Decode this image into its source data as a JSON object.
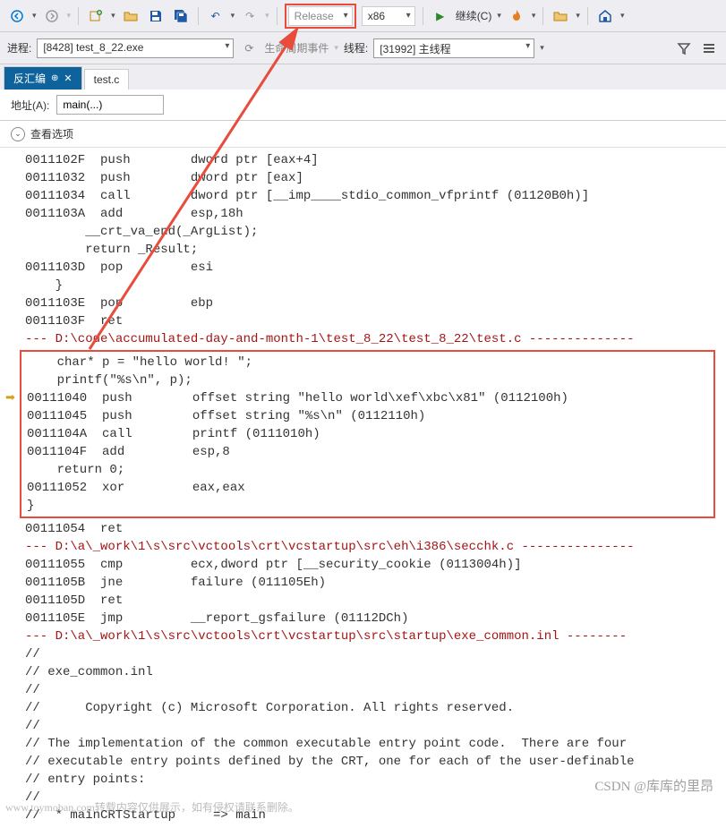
{
  "toolbar": {
    "config": "Release",
    "platform": "x86",
    "continue_label": "继续(C)"
  },
  "subbar": {
    "process_label": "进程:",
    "process_value": "[8428] test_8_22.exe",
    "lifecycle_label": "生命周期事件",
    "thread_label": "线程:",
    "thread_value": "[31992] 主线程"
  },
  "tabs": {
    "disasm": "反汇编",
    "file": "test.c"
  },
  "address": {
    "label": "地址(A):",
    "value": "main(...)"
  },
  "view_options": "查看选项",
  "code": [
    {
      "t": "0011102F  push        dword ptr [eax+4]  "
    },
    {
      "t": "00111032  push        dword ptr [eax]  "
    },
    {
      "t": "00111034  call        dword ptr [__imp____stdio_common_vfprintf (01120B0h)]  "
    },
    {
      "t": "0011103A  add         esp,18h  "
    },
    {
      "t": "        __crt_va_end(_ArgList);"
    },
    {
      "t": "        return _Result;"
    },
    {
      "t": "0011103D  pop         esi  "
    },
    {
      "t": "    }"
    },
    {
      "t": "0011103E  pop         ebp  "
    },
    {
      "t": "0011103F  ret  "
    },
    {
      "t": "--- D:\\code\\accumulated-day-and-month-1\\test_8_22\\test_8_22\\test.c --------------",
      "red": true
    }
  ],
  "boxed_code": [
    {
      "t": "    char* p = \"hello world! \";"
    },
    {
      "t": "    printf(\"%s\\n\", p);"
    },
    {
      "t": "00111040  push        offset string \"hello world\\xef\\xbc\\x81\" (0112100h)  ",
      "arrow": true
    },
    {
      "t": "00111045  push        offset string \"%s\\n\" (0112110h)  "
    },
    {
      "t": "0011104A  call        printf (0111010h)  "
    },
    {
      "t": "0011104F  add         esp,8  "
    },
    {
      "t": "    return 0;"
    },
    {
      "t": "00111052  xor         eax,eax  "
    },
    {
      "t": "}"
    }
  ],
  "code_after": [
    {
      "t": "00111054  ret  "
    },
    {
      "t": "--- D:\\a\\_work\\1\\s\\src\\vctools\\crt\\vcstartup\\src\\eh\\i386\\secchk.c ---------------",
      "red": true
    },
    {
      "t": "00111055  cmp         ecx,dword ptr [__security_cookie (0113004h)]  "
    },
    {
      "t": "0011105B  jne         failure (011105Eh)  "
    },
    {
      "t": "0011105D  ret  "
    },
    {
      "t": "0011105E  jmp         __report_gsfailure (01112DCh)  "
    },
    {
      "t": "--- D:\\a\\_work\\1\\s\\src\\vctools\\crt\\vcstartup\\src\\startup\\exe_common.inl --------",
      "red": true
    },
    {
      "t": "//"
    },
    {
      "t": "// exe_common.inl"
    },
    {
      "t": "//"
    },
    {
      "t": "//      Copyright (c) Microsoft Corporation. All rights reserved."
    },
    {
      "t": "//"
    },
    {
      "t": "// The implementation of the common executable entry point code.  There are four"
    },
    {
      "t": "// executable entry points defined by the CRT, one for each of the user-definable"
    },
    {
      "t": "// entry points:"
    },
    {
      "t": "//"
    },
    {
      "t": "//  * mainCRTStartup     => main"
    }
  ],
  "watermark1": "CSDN @库库的里昂",
  "watermark2": "www.toymoban.com转载内容仅供展示，如有侵权请联系删除。"
}
